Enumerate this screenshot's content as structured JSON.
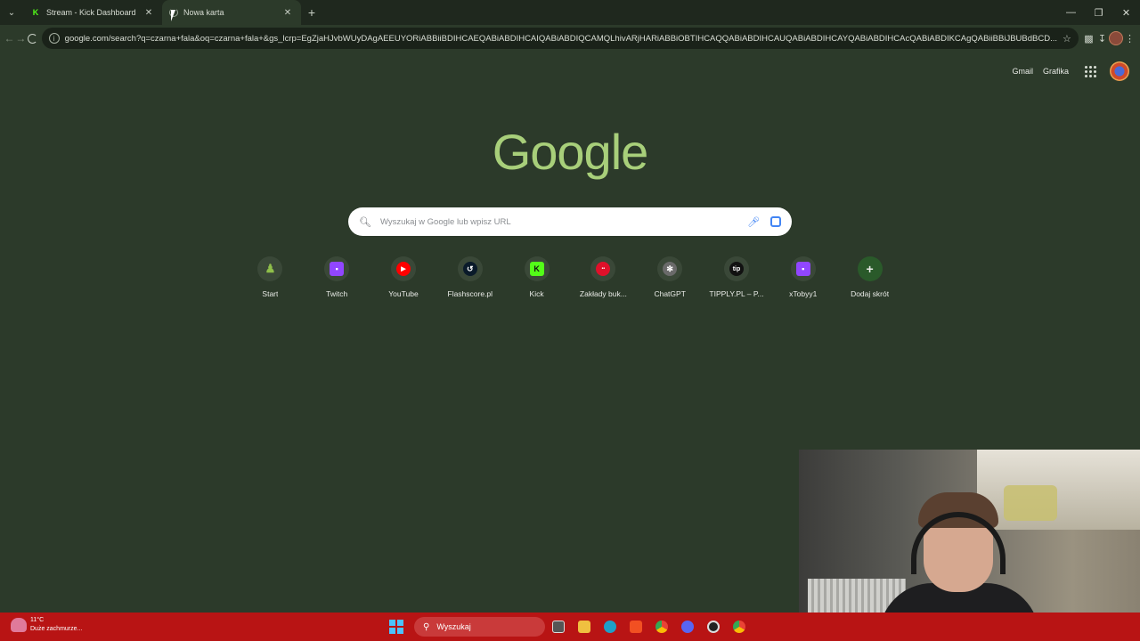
{
  "browser": {
    "tabs": [
      {
        "title": "Stream - Kick Dashboard",
        "favicon": "kick-icon",
        "active": false
      },
      {
        "title": "Nowa karta",
        "favicon": "loading-spinner-icon",
        "active": true
      }
    ],
    "address": "google.com/search?q=czarna+fala&oq=czarna+fala+&gs_lcrp=EgZjaHJvbWUyDAgAEEUYORiABBiiBDIHCAEQABiABDIHCAIQABiABDIQCAMQLhivARjHARiABBiOBTIHCAQQABiABDIHCAUQABiABDIHCAYQABiABDIHCAcQABiABDIKCAgQABiiBBiJBUBdBCD..."
  },
  "ntp": {
    "links": {
      "gmail": "Gmail",
      "images": "Grafika"
    },
    "logo": "Google",
    "search_placeholder": "Wyszukaj w Google lub wpisz URL",
    "shortcuts": [
      {
        "label": "Start",
        "icon": "chess-pawn-icon",
        "color": "#8fbf4a"
      },
      {
        "label": "Twitch",
        "icon": "twitch-icon",
        "color": "#9146ff"
      },
      {
        "label": "YouTube",
        "icon": "youtube-icon",
        "color": "#ff0000"
      },
      {
        "label": "Flashscore.pl",
        "icon": "flashscore-icon",
        "color": "#0a1a2a"
      },
      {
        "label": "Kick",
        "icon": "kick-icon",
        "color": "#53fc18"
      },
      {
        "label": "Zakłady buk...",
        "icon": "betting-icon",
        "color": "#e0102a"
      },
      {
        "label": "ChatGPT",
        "icon": "chatgpt-icon",
        "color": "#6a6a6a"
      },
      {
        "label": "TIPPLY.PL – P...",
        "icon": "tipply-icon",
        "color": "#111111"
      },
      {
        "label": "xTobyy1",
        "icon": "twitch-icon",
        "color": "#9146ff"
      },
      {
        "label": "Dodaj skrót",
        "icon": "plus-icon",
        "color": "#2a6a2a"
      }
    ]
  },
  "taskbar": {
    "weather_temp": "11°C",
    "weather_desc": "Duże zachmurze...",
    "search_label": "Wyszukaj"
  }
}
